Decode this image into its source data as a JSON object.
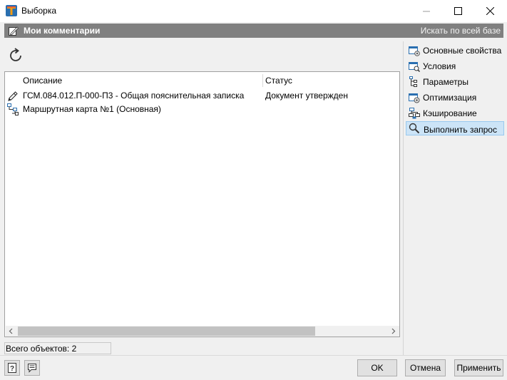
{
  "window": {
    "title": "Выборка"
  },
  "header": {
    "title": "Мои комментарии",
    "search_link": "Искать по всей базе"
  },
  "table": {
    "columns": [
      "Описание",
      "Статус"
    ],
    "rows": [
      {
        "icon": "pencil-icon",
        "description": "ГСМ.084.012.П-000-П3 - Общая пояснительная записка",
        "status": "Документ утвержден"
      },
      {
        "icon": "route-map-icon",
        "description": "Маршрутная карта №1 (Основная)",
        "status": ""
      }
    ]
  },
  "status_bar": {
    "text": "Всего объектов: 2"
  },
  "sidebar": {
    "items": [
      {
        "label": "Основные свойства",
        "icon": "properties-icon"
      },
      {
        "label": "Условия",
        "icon": "conditions-icon"
      },
      {
        "label": "Параметры",
        "icon": "parameters-icon"
      },
      {
        "label": "Оптимизация",
        "icon": "optimization-icon"
      },
      {
        "label": "Кэширование",
        "icon": "caching-icon"
      },
      {
        "label": "Выполнить запрос",
        "icon": "search-icon",
        "active": true
      }
    ]
  },
  "buttons": {
    "ok": "OK",
    "cancel": "Отмена",
    "apply": "Применить"
  },
  "colors": {
    "header_bg": "#808080",
    "active_item_bg": "#cce4f7"
  }
}
